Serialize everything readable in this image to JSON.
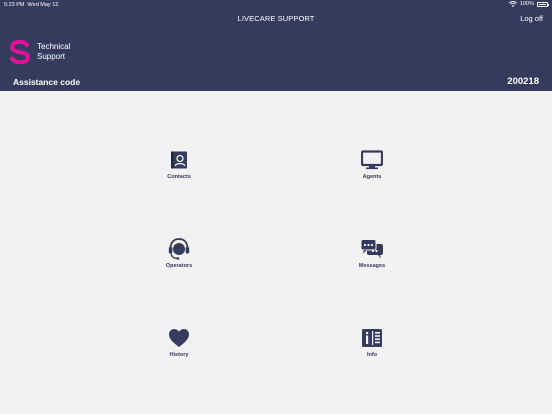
{
  "status_bar": {
    "time": "5:23 PM",
    "date": "Wed May 12",
    "battery": "100%"
  },
  "nav": {
    "title": "LIVECARE SUPPORT",
    "logoff_label": "Log off"
  },
  "brand": {
    "line1": "Technical",
    "line2": "Support",
    "logo_letter": "S",
    "logo_color": "#e0119a"
  },
  "assistance": {
    "label": "Assistance code",
    "code": "200218"
  },
  "colors": {
    "header_bg": "#353b5c",
    "page_bg": "#f2f2f2",
    "icon": "#353b5c"
  },
  "menu": [
    {
      "label": "Contacts",
      "icon": "contacts-icon"
    },
    {
      "label": "Agents",
      "icon": "monitor-icon"
    },
    {
      "label": "Operators",
      "icon": "headset-icon"
    },
    {
      "label": "Messages",
      "icon": "chat-bubbles-icon"
    },
    {
      "label": "History",
      "icon": "heart-icon"
    },
    {
      "label": "Info",
      "icon": "info-panel-icon"
    }
  ]
}
